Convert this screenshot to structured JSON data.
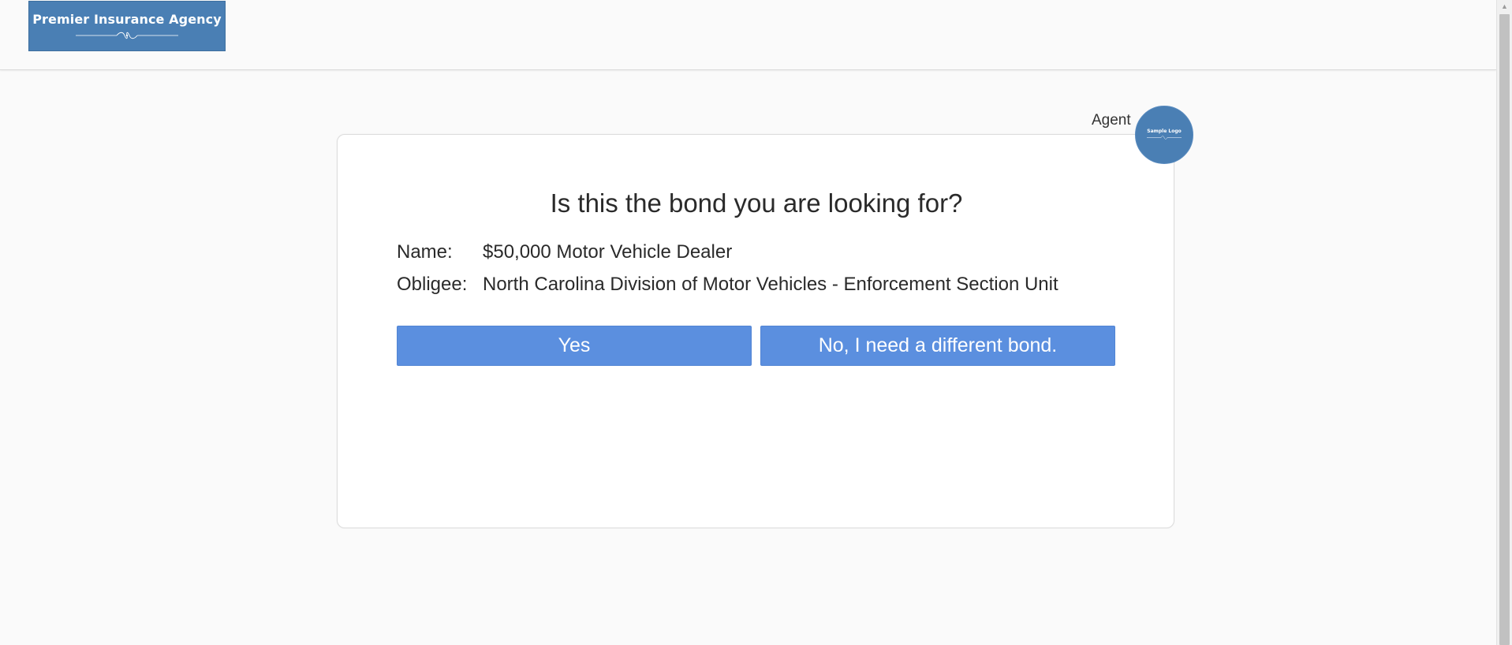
{
  "header": {
    "brand": {
      "name": "Premier Insurance Agency",
      "color": "#4a7fb4"
    }
  },
  "agent": {
    "label": "Agent",
    "logo_text": "Sample Logo"
  },
  "bond_confirm": {
    "title": "Is this the bond you are looking for?",
    "name_label": "Name:",
    "name_value": "$50,000 Motor Vehicle Dealer",
    "obligee_label": "Obligee:",
    "obligee_value": "North Carolina Division of Motor Vehicles - Enforcement Section Unit",
    "yes_label": "Yes",
    "no_label": "No, I need a different bond.",
    "button_color": "#5b8fdf"
  },
  "scrollbar": {
    "up_icon": "scroll-up-arrow"
  }
}
